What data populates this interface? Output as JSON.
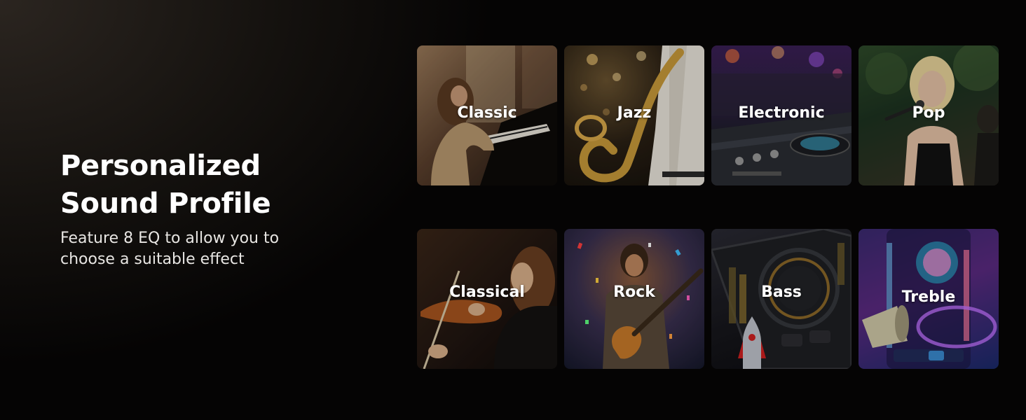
{
  "hero": {
    "title": "Personalized\nSound Profile",
    "subtitle": "Feature 8 EQ to allow you to\nchoose a suitable effect"
  },
  "eq_presets": [
    {
      "label": "Classic"
    },
    {
      "label": "Jazz"
    },
    {
      "label": "Electronic"
    },
    {
      "label": "Pop"
    },
    {
      "label": "Classical"
    },
    {
      "label": "Rock"
    },
    {
      "label": "Bass"
    },
    {
      "label": "Treble"
    }
  ]
}
